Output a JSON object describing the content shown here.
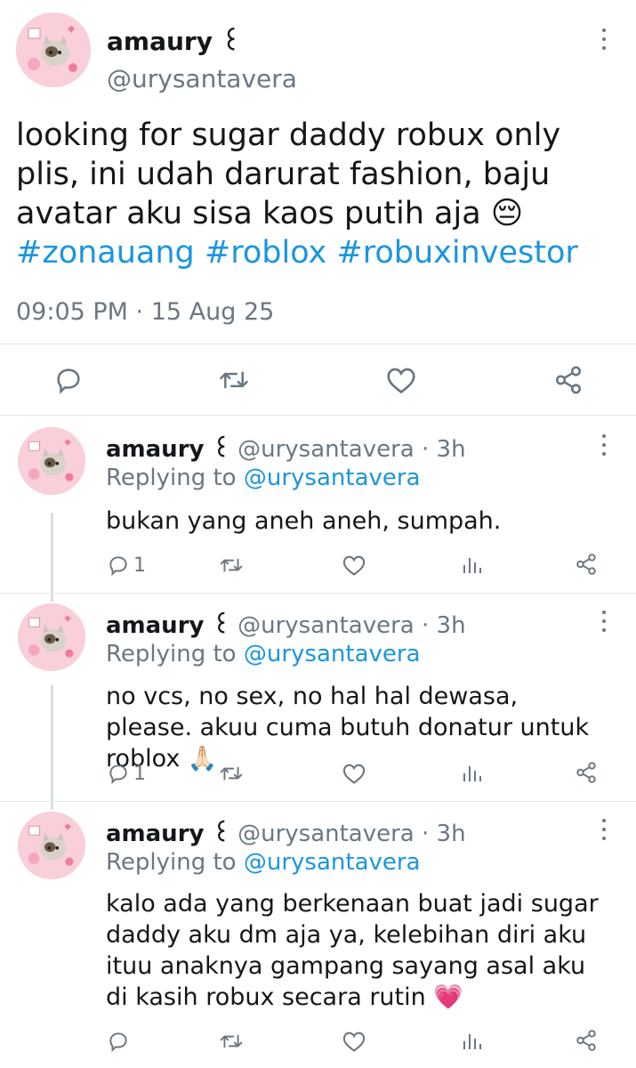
{
  "main_tweet": {
    "author_name": "amaury ꒰",
    "author_handle": "@urysantavera",
    "text": "looking for sugar daddy robux only plis, ini udah darurat fashion, baju avatar aku sisa kaos putih aja 😔",
    "hashtags": "#zonauang #roblox #robuxinvestor",
    "timestamp": "09:05 PM · 15 Aug 25",
    "actions": [
      "reply-icon",
      "retweet-icon",
      "like-icon",
      "share-icon"
    ]
  },
  "replies": [
    {
      "author_name": "amaury ꒰",
      "author_handle": "@urysantavera",
      "time": "· 3h",
      "replying_label": "Replying to",
      "replying_handle": "@urysantavera",
      "text": "bukan yang aneh aneh, sumpah.",
      "reply_count": "1",
      "actions": [
        "reply-icon",
        "retweet-icon",
        "like-icon",
        "analytics-icon",
        "share-icon"
      ]
    },
    {
      "author_name": "amaury ꒰",
      "author_handle": "@urysantavera",
      "time": "· 3h",
      "replying_label": "Replying to",
      "replying_handle": "@urysantavera",
      "text": "no vcs, no sex, no hal hal dewasa, please. akuu cuma butuh donatur untuk roblox 🙏🏻",
      "reply_count": "1",
      "actions": [
        "reply-icon",
        "retweet-icon",
        "like-icon",
        "analytics-icon",
        "share-icon"
      ]
    },
    {
      "author_name": "amaury ꒰",
      "author_handle": "@urysantavera",
      "time": "· 3h",
      "replying_label": "Replying to",
      "replying_handle": "@urysantavera",
      "text": "kalo ada yang berkenaan buat jadi sugar daddy aku dm aja ya, kelebihan diri aku ituu anaknya gampang sayang asal aku di kasih robux secara rutin 💗",
      "reply_count": "",
      "actions": [
        "reply-icon",
        "retweet-icon",
        "like-icon",
        "analytics-icon",
        "share-icon"
      ]
    }
  ],
  "colors": {
    "link": "#1b95e0",
    "muted": "#6b7781",
    "avatar_bg": "#f9cfd9",
    "divider": "#e1e8ed"
  }
}
